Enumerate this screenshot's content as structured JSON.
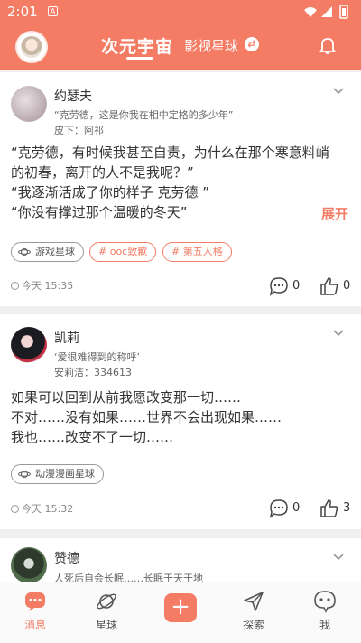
{
  "status_bar": {
    "time": "2:01",
    "sim_badge": "A"
  },
  "header": {
    "title": "次元宇宙",
    "alt_title": "影视星球",
    "swap_icon": "⇄",
    "bell_icon": "bell-icon",
    "avatar_icon": "avatar"
  },
  "posts": [
    {
      "author": "约瑟夫",
      "signature": "“克劳德，这是你我在相中定格的多少年”",
      "skin": "皮下：阿祁",
      "body": [
        "“克劳德，有时候我甚至自责，为什么在那个寒意料峭",
        "的初春，离开的人不是我呢？”",
        "“我逐渐活成了你的样子 克劳德 ”",
        "“你没有撑过那个温暖的冬天”"
      ],
      "expand_label": "展开",
      "tags": [
        {
          "label": "游戏星球",
          "style": "gray"
        },
        {
          "label": "# ooc致歉",
          "style": "orange"
        },
        {
          "label": "# 第五人格",
          "style": "orange"
        }
      ],
      "timestamp": "今天 15:35",
      "comments": "0",
      "likes": "0"
    },
    {
      "author": "凯莉",
      "signature": "‘爱很难得到的称呼’",
      "skin": "安莉洁：334613",
      "body": [
        "如果可以回到从前我愿改变那一切……",
        "不对……没有如果……世界不会出现如果……",
        "我也……改变不了一切……"
      ],
      "tags": [
        {
          "label": "动漫漫画星球",
          "style": "gray"
        }
      ],
      "timestamp": "今天 15:32",
      "comments": "0",
      "likes": "3"
    },
    {
      "author": "赞德",
      "signature": "人死后自会长眠……长眠于天于地"
    }
  ],
  "bottom_nav": {
    "items": [
      {
        "label": "消息",
        "icon": "message-icon",
        "active": true
      },
      {
        "label": "星球",
        "icon": "planet-icon"
      },
      {
        "label": "+",
        "icon": "add-icon"
      },
      {
        "label": "探索",
        "icon": "explore-icon"
      },
      {
        "label": "我",
        "icon": "profile-icon"
      }
    ]
  },
  "colors": {
    "accent": "#f47c65",
    "background": "#efefef"
  }
}
